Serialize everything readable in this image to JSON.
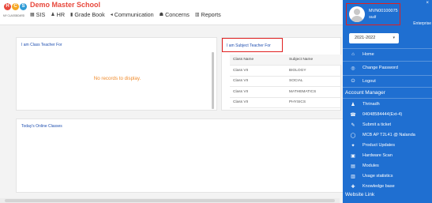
{
  "header": {
    "school_name": "Demo Master School",
    "logo_letters": [
      "H",
      "C",
      "S"
    ],
    "logo_tagline": "MY CLASSBOARD",
    "nav": [
      {
        "label": "SIS",
        "icon": "grid-icon"
      },
      {
        "label": "HR",
        "icon": "person-icon"
      },
      {
        "label": "Grade Book",
        "icon": "book-icon"
      },
      {
        "label": "Communication",
        "icon": "megaphone-icon"
      },
      {
        "label": "Concerns",
        "icon": "concerns-icon"
      },
      {
        "label": "Reports",
        "icon": "bar-chart-icon"
      }
    ]
  },
  "main": {
    "class_teacher": {
      "title": "I am Class Teacher For",
      "empty_text": "No records to display."
    },
    "subject_teacher": {
      "title": "I am Subject Teacher For",
      "columns": [
        "Class Name",
        "Subject Name"
      ],
      "rows": [
        [
          "Class VII",
          "BIOLOGY"
        ],
        [
          "Class VII",
          "SOCIAL"
        ],
        [
          "Class VII",
          "MATHEMATICS"
        ],
        [
          "Class VII",
          "PHYSICS"
        ]
      ]
    },
    "online_classes": {
      "title": "Today's Online Classes"
    }
  },
  "drawer": {
    "close": "×",
    "user": {
      "id": "MVN00100075",
      "role": "Staff"
    },
    "plan": "Enterprise",
    "year": "2021-2022",
    "menu": [
      {
        "label": "Home",
        "icon": "home-icon"
      },
      {
        "label": "Change Password",
        "icon": "key-icon"
      },
      {
        "label": "Logout",
        "icon": "logout-icon"
      }
    ],
    "account_manager": {
      "title": "Account Manager",
      "items": [
        {
          "label": "Thrinadh",
          "icon": "person-icon"
        },
        {
          "label": "04048584444(Ext-4)",
          "icon": "phone-icon"
        },
        {
          "label": "Submit a ticket",
          "icon": "ticket-icon"
        },
        {
          "label": "MCB AP T2L41 @ Nalanda",
          "icon": "whatsapp-icon"
        },
        {
          "label": "Product Updates",
          "icon": "updates-icon"
        },
        {
          "label": "Hardware Scan",
          "icon": "scan-icon"
        },
        {
          "label": "Modules",
          "icon": "modules-icon"
        },
        {
          "label": "Usage statistics",
          "icon": "stats-icon"
        },
        {
          "label": "Knowledge base",
          "icon": "knowledge-icon"
        }
      ]
    },
    "website_link": "Website Link"
  },
  "colors": {
    "brand_red": "#e8483c",
    "drawer_blue": "#1f6fd1",
    "link_blue": "#1f4fb0",
    "empty_orange": "#f08b2c",
    "highlight_red": "#e02020"
  }
}
